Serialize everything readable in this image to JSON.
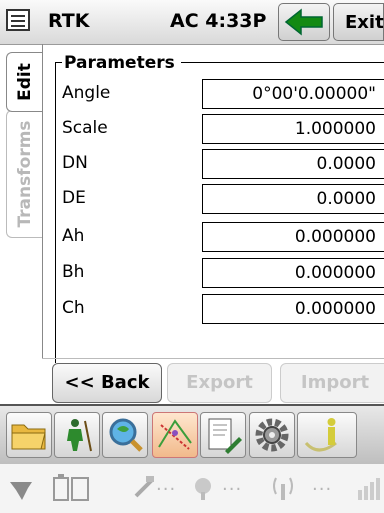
{
  "titlebar": {
    "title": "RTK",
    "status": "AC 4:33P",
    "exit_label": "Exit"
  },
  "tabs": [
    {
      "label": "Edit",
      "active": true
    },
    {
      "label": "Transforms",
      "active": false
    }
  ],
  "group": {
    "title": "Parameters",
    "rows": [
      {
        "label": "Angle",
        "value": "0°00'0.00000\""
      },
      {
        "label": "Scale",
        "value": "1.000000"
      },
      {
        "label": "DN",
        "value": "0.0000"
      },
      {
        "label": "DE",
        "value": "0.0000"
      },
      {
        "label": "Ah",
        "value": "0.000000"
      },
      {
        "label": "Bh",
        "value": "0.000000"
      },
      {
        "label": "Ch",
        "value": "0.000000"
      }
    ]
  },
  "buttons": {
    "back": "<< Back",
    "export": "Export",
    "import": "Import"
  },
  "toolbar": {
    "icons": [
      "folder-icon",
      "surveyor-icon",
      "magnifier-globe-icon",
      "cogo-map-icon",
      "document-pen-icon",
      "gear-icon",
      "info-icon"
    ],
    "active_index": 3
  },
  "statusbar": {
    "icons": [
      "gps-antenna-icon",
      "battery-icon",
      "satellite-icon",
      "satellite-dish-icon",
      "radio-icon",
      "signal-bars-icon"
    ],
    "dots": "..."
  },
  "colors": {
    "accent_green": "#138a13",
    "disabled_text": "#c5c5c5"
  }
}
